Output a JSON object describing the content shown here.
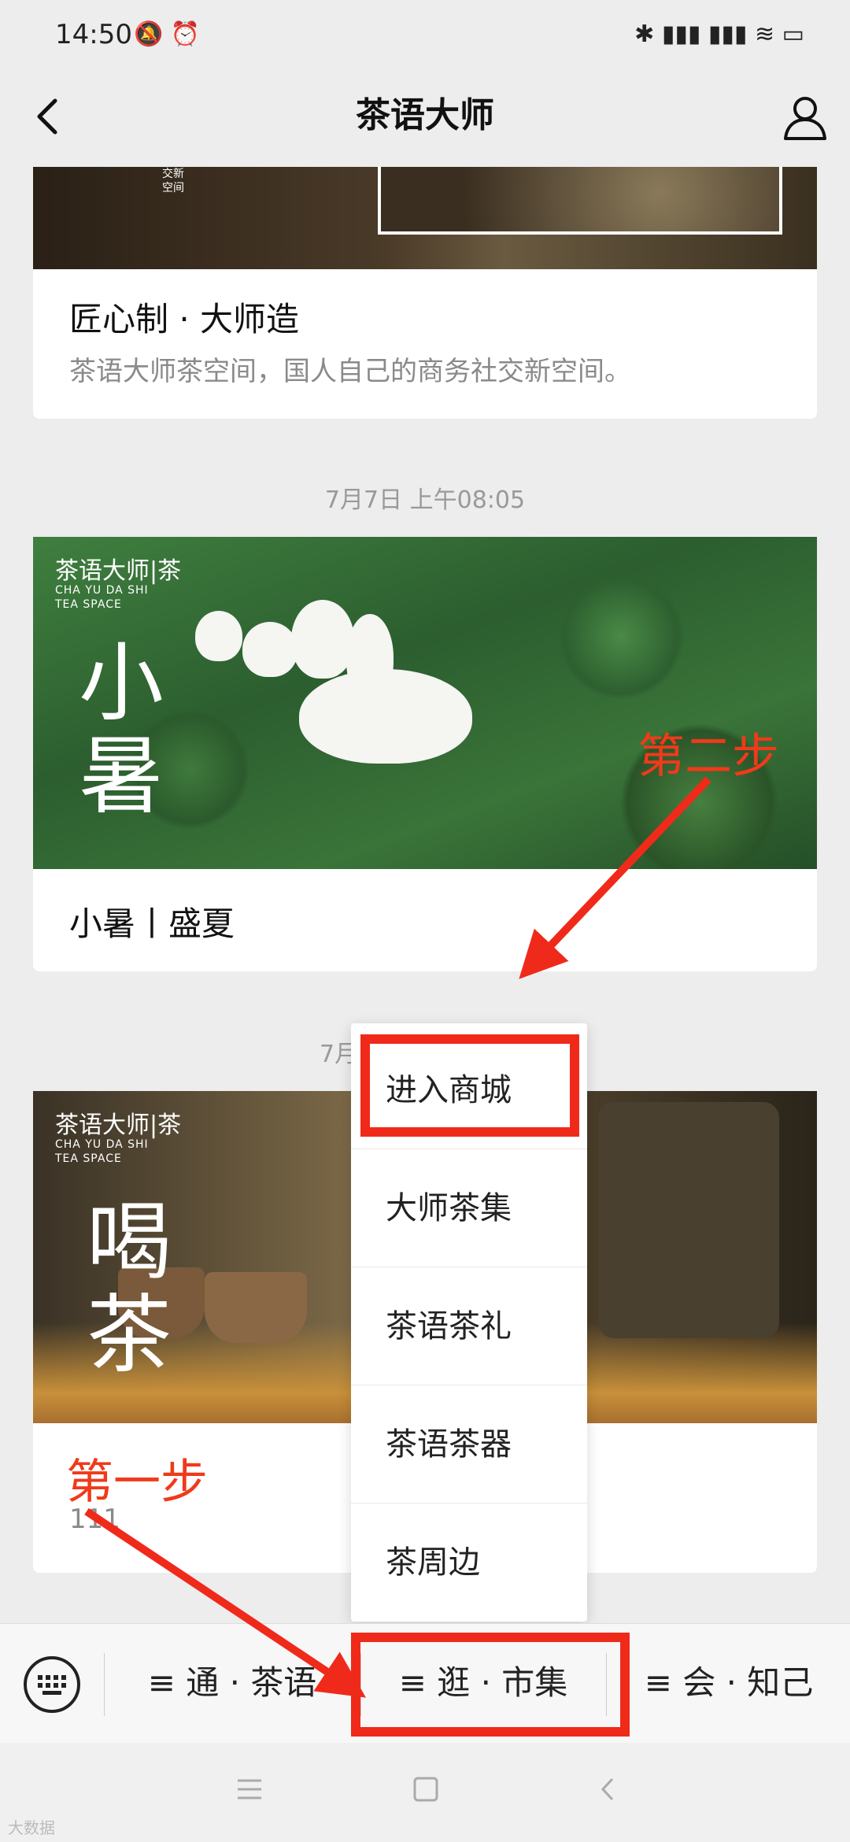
{
  "status_bar": {
    "time": "14:50",
    "left_icons": "🔕 ⏰",
    "right_icons": "✱ ▮▮▮ ▮▮▮ ≋ ▭"
  },
  "nav": {
    "title": "茶语大师"
  },
  "cards": [
    {
      "title": "匠心制 · 大师造",
      "subtitle": "茶语大师茶空间，国人自己的商务社交新空间。",
      "image_caption": "交新空间"
    },
    {
      "timestamp": "7月7日 上午08:05",
      "title": "小暑丨盛夏",
      "brand": "茶语大师|茶",
      "brand_en": "CHA YU DA SHI",
      "brand_en2": "TEA SPACE",
      "big_text_1": "小",
      "big_text_2": "暑"
    },
    {
      "timestamp": "7月",
      "subtitle": "111",
      "brand": "茶语大师|茶",
      "brand_en": "CHA YU DA SHI",
      "brand_en2": "TEA SPACE",
      "big_text_1": "喝",
      "big_text_2": "茶"
    }
  ],
  "popup_menu": {
    "items": [
      "进入商城",
      "大师茶集",
      "茶语茶礼",
      "茶语茶器",
      "茶周边"
    ]
  },
  "bottom_menu": {
    "items": [
      "≡ 通 · 茶语",
      "≡ 逛 · 市集",
      "≡ 会 · 知己"
    ]
  },
  "annotations": {
    "step1": "第一步",
    "step2": "第二步"
  },
  "watermark": "大数据"
}
